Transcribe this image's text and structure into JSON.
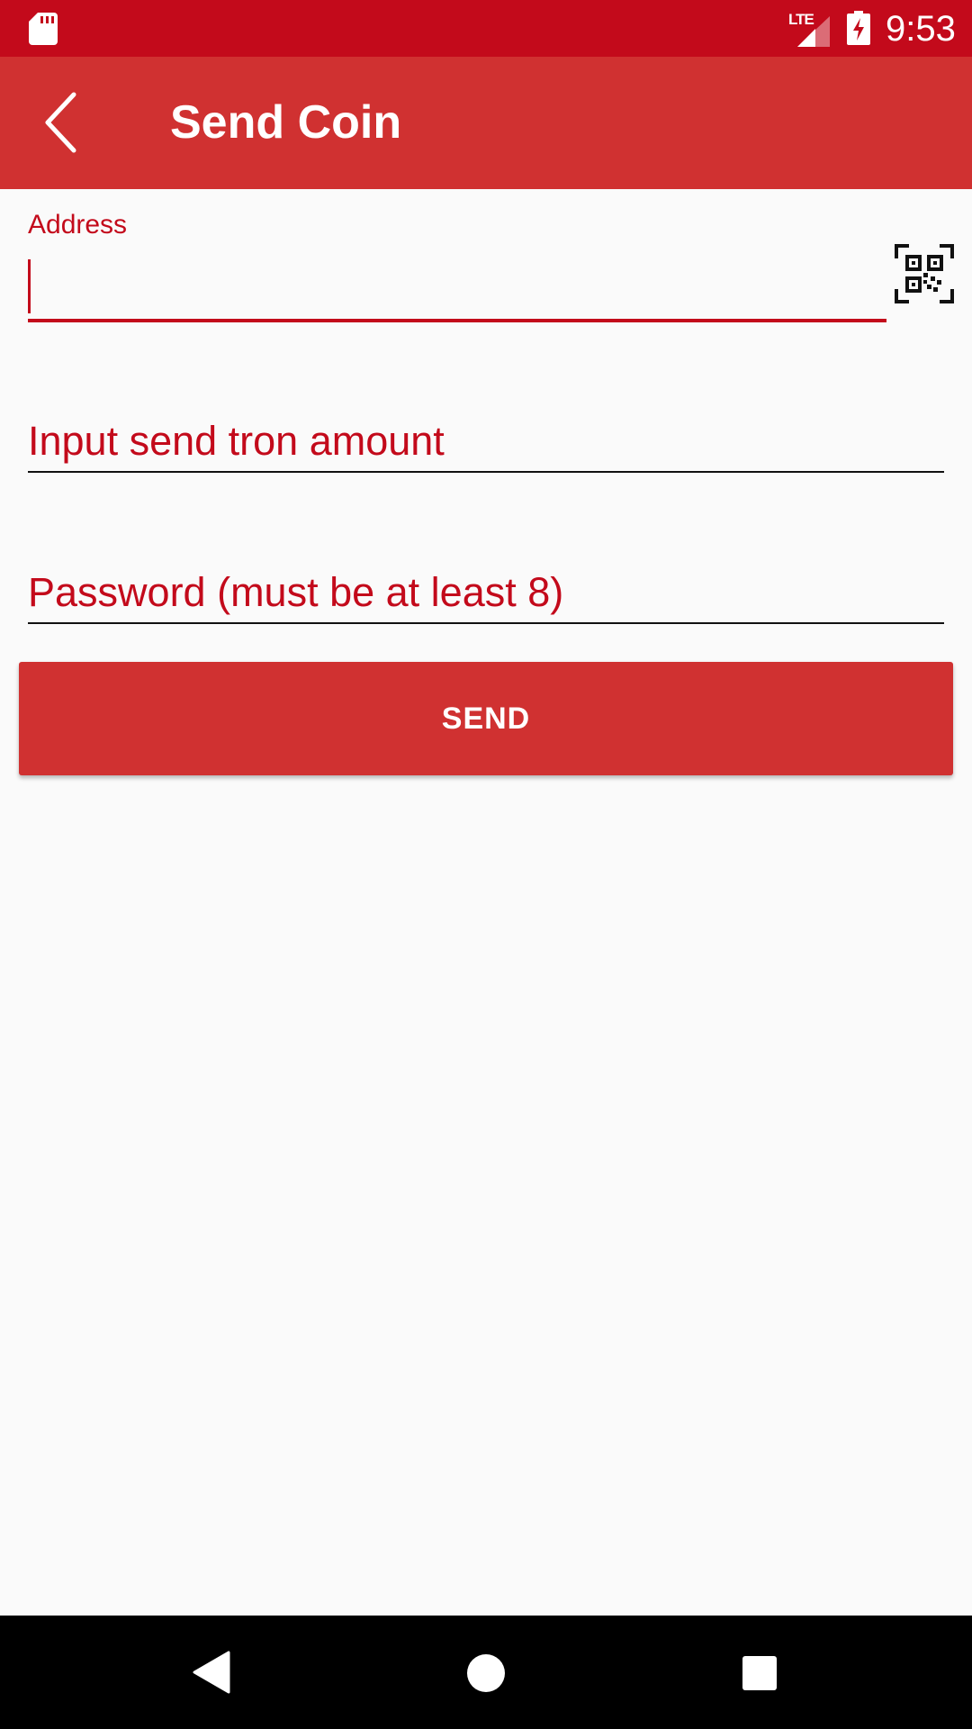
{
  "status_bar": {
    "time": "9:53",
    "network": "LTE",
    "icons": [
      "sd-card-icon",
      "signal-icon",
      "battery-charging-icon"
    ]
  },
  "app_bar": {
    "title": "Send Coin",
    "back_icon": "back-arrow-icon"
  },
  "form": {
    "address_label": "Address",
    "address_value": "",
    "qr_icon": "qr-scan-icon",
    "amount_placeholder": "Input send tron amount",
    "password_placeholder": "Password (must be at least 8)",
    "send_label": "SEND"
  },
  "nav_bar": {
    "icons": [
      "nav-back-icon",
      "nav-home-icon",
      "nav-recents-icon"
    ]
  },
  "colors": {
    "status_bar": "#c30a1b",
    "app_bar": "#d03131",
    "accent": "#c30a1b",
    "background": "#fafafa",
    "nav_bar": "#000000"
  }
}
